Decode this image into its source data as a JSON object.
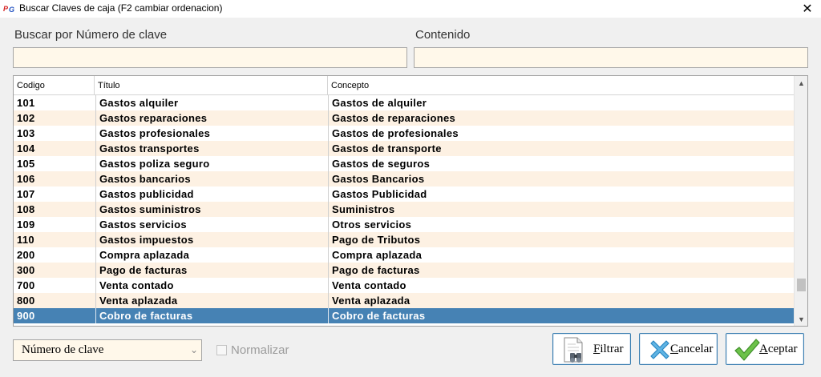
{
  "window": {
    "title": "Buscar Claves de caja  (F2 cambiar ordenacion)",
    "app_icon": "pg-logo-icon",
    "close_glyph": "✕"
  },
  "search": {
    "clave_label": "Buscar por Número de clave",
    "contenido_label": "Contenido",
    "clave_value": "",
    "contenido_value": ""
  },
  "grid": {
    "columns": [
      "Codigo",
      "Título",
      "Concepto"
    ],
    "rows": [
      {
        "codigo": "101",
        "titulo": "Gastos alquiler",
        "concepto": "Gastos de alquiler"
      },
      {
        "codigo": "102",
        "titulo": "Gastos reparaciones",
        "concepto": "Gastos de reparaciones"
      },
      {
        "codigo": "103",
        "titulo": "Gastos profesionales",
        "concepto": "Gastos de profesionales"
      },
      {
        "codigo": "104",
        "titulo": "Gastos transportes",
        "concepto": "Gastos de transporte"
      },
      {
        "codigo": "105",
        "titulo": "Gastos poliza seguro",
        "concepto": "Gastos de seguros"
      },
      {
        "codigo": "106",
        "titulo": "Gastos bancarios",
        "concepto": "Gastos Bancarios"
      },
      {
        "codigo": "107",
        "titulo": "Gastos publicidad",
        "concepto": "Gastos Publicidad"
      },
      {
        "codigo": "108",
        "titulo": "Gastos suministros",
        "concepto": "Suministros"
      },
      {
        "codigo": "109",
        "titulo": "Gastos servicios",
        "concepto": "Otros servicios"
      },
      {
        "codigo": "110",
        "titulo": "Gastos impuestos",
        "concepto": "Pago de Tributos"
      },
      {
        "codigo": "200",
        "titulo": "Compra aplazada",
        "concepto": "Compra aplazada"
      },
      {
        "codigo": "300",
        "titulo": "Pago de facturas",
        "concepto": "Pago de facturas"
      },
      {
        "codigo": "700",
        "titulo": "Venta contado",
        "concepto": "Venta contado"
      },
      {
        "codigo": "800",
        "titulo": "Venta aplazada",
        "concepto": "Venta aplazada"
      },
      {
        "codigo": "900",
        "titulo": "Cobro de facturas",
        "concepto": "Cobro de facturas"
      }
    ],
    "selected_index": 14,
    "scroll_position": 0.9
  },
  "footer": {
    "order_selected": "Número de clave",
    "normalizar_label": "Normalizar",
    "normalizar_checked": false,
    "filtrar_key": "F",
    "filtrar_rest": "iltrar",
    "cancelar_key": "C",
    "cancelar_rest": "ancelar",
    "aceptar_key": "A",
    "aceptar_rest": "ceptar"
  },
  "colors": {
    "selection": "#4682b4",
    "alt_row": "#fdf1e3",
    "input_bg": "#fff8ea",
    "button_border": "#3c7fb1"
  }
}
